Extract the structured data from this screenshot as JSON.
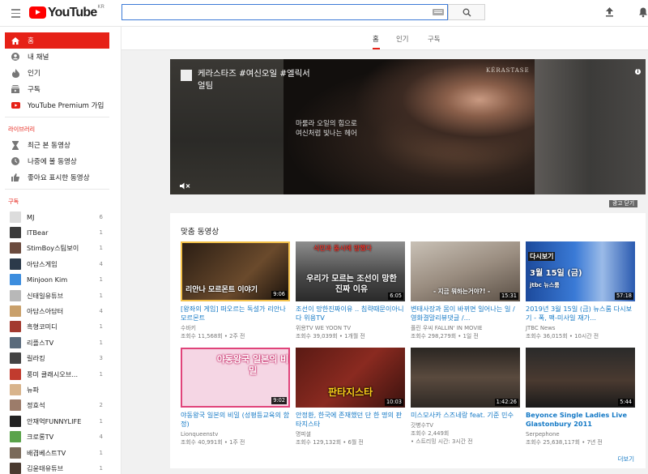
{
  "header": {
    "logo_text": "YouTube",
    "logo_region": "KR",
    "search_placeholder": ""
  },
  "sidebar": {
    "main": [
      {
        "label": "홈",
        "icon": "home-icon",
        "active": true
      },
      {
        "label": "내 채널",
        "icon": "person-icon"
      },
      {
        "label": "인기",
        "icon": "flame-icon"
      },
      {
        "label": "구독",
        "icon": "subscriptions-icon"
      },
      {
        "label": "YouTube Premium 가입",
        "icon": "youtube-icon"
      }
    ],
    "library_title": "라이브러리",
    "library": [
      {
        "label": "최근 본 동영상",
        "icon": "hourglass-icon"
      },
      {
        "label": "나중에 볼 동영상",
        "icon": "clock-icon"
      },
      {
        "label": "좋아요 표시한 동영상",
        "icon": "thumbs-up-icon"
      }
    ],
    "subs_title": "구독",
    "subs": [
      {
        "name": "MJ",
        "count": "6",
        "color": "#dcdcdc"
      },
      {
        "name": "ITBear",
        "count": "1",
        "color": "#3b3b3b"
      },
      {
        "name": "StimBoy스팀보이",
        "count": "1",
        "color": "#6b4b3e"
      },
      {
        "name": "아담스게임",
        "count": "4",
        "color": "#2c3a4a"
      },
      {
        "name": "Minjoon Kim",
        "count": "1",
        "color": "#3c8dde"
      },
      {
        "name": "신태일유튜브",
        "count": "1",
        "color": "#b8b8b8"
      },
      {
        "name": "아담스아담터",
        "count": "4",
        "color": "#c9a06b"
      },
      {
        "name": "흑형코미디",
        "count": "1",
        "color": "#a33a2f"
      },
      {
        "name": "리플스TV",
        "count": "1",
        "color": "#5a6b7c"
      },
      {
        "name": "릴라킹",
        "count": "3",
        "color": "#444"
      },
      {
        "name": "풍미 클래시오브...",
        "count": "1",
        "color": "#c13b2e"
      },
      {
        "name": "뉴파",
        "count": "",
        "color": "#d8b48c"
      },
      {
        "name": "정효석",
        "count": "2",
        "color": "#9c7c6a"
      },
      {
        "name": "안재억FUNNYLIFE",
        "count": "1",
        "color": "#222"
      },
      {
        "name": "크로롱TV",
        "count": "4",
        "color": "#5aa34a"
      },
      {
        "name": "배겹베스트TV",
        "count": "1",
        "color": "#7a6a5a"
      },
      {
        "name": "김윤태유튜브",
        "count": "1",
        "color": "#4a3a30"
      },
      {
        "name": "",
        "count": "",
        "color": "#888"
      }
    ]
  },
  "tabs": [
    {
      "label": "홈"
    },
    {
      "label": "인기"
    },
    {
      "label": "구독"
    }
  ],
  "ad": {
    "title": "케라스타즈 #여신오일 #엘릭서얼팀",
    "copy_line1": "마룰라 오일의 힘으로",
    "copy_line2": "여신처럼 빛나는 헤어",
    "brand": "KÉRASTASE",
    "close_label": "광고 닫기"
  },
  "recommended": {
    "title": "맞춤 동영상",
    "more": "더보기",
    "videos": [
      {
        "title": "[왕좌의 게임] 떠오르는 독설가 리안나 모르몬트",
        "channel": "수바키",
        "meta": "조회수 11,568회 • 2주 전",
        "duration": "9:06",
        "thumb_text": "리안나 모르몬트 이야기",
        "bold": false
      },
      {
        "title": "조선이 망한진짜이유 .. 침략때문이아니다 위용TV",
        "channel": "위용TV WE YOON TV",
        "meta": "조회수 39,039회 • 1개월 전",
        "duration": "6:05",
        "thumb_text": "우리가 모르는 조선이 망한 진짜 이유",
        "thumb_top": "식민과 동시에 망했다",
        "bold": false
      },
      {
        "title": "변태사장과 몸이 바뀌면 일어나는 일 / 영화결말리뷰댓글 /...",
        "channel": "폴린 우씨 FALLIN' IN MOVIE",
        "meta": "조회수 298,279회 • 1일 전",
        "duration": "15:31",
        "thumb_text": "- 지금 뭐하는거야?! -",
        "bold": false
      },
      {
        "title": "2019년 3월 15일 (금) 뉴스룸 다시보기 - 폭, 팩-미사일 재가...",
        "channel": "JTBC News",
        "meta": "조회수 36,015회 • 10시간 전",
        "duration": "57:18",
        "thumb_text": "3월 15일 (금)",
        "thumb_top": "다시보기",
        "thumb_brand": "jtbc 뉴스룸",
        "bold": false
      },
      {
        "title": "야동왕국 일본의 비밀 (성평등교육의 함정)",
        "channel": "Lionqueenstv",
        "meta": "조회수 40,991회 • 1주 전",
        "duration": "9:02",
        "thumb_text": "야동왕국 일본의 비밀",
        "bold": false
      },
      {
        "title": "안정환, 한국에 존재했던 단 한 명의 판타지스타",
        "channel": "명피셜",
        "meta": "조회수 129,132회 • 6월 전",
        "duration": "10:03",
        "thumb_text": "판타지스타",
        "bold": false
      },
      {
        "title": "미스모사카 스즈네랑 feat. 기준 민수",
        "channel": "갓병수TV",
        "meta": "조회수 2,449회",
        "meta2": "• 스트리밍 시간: 3시간 전",
        "duration": "1:42:26",
        "thumb_text": "",
        "bold": false
      },
      {
        "title": "Beyonce Single Ladies Live Glastonbury 2011",
        "channel": "Serpephone",
        "meta": "조회수 25,638,117회 • 7년 전",
        "duration": "5:44",
        "thumb_text": "",
        "bold": true
      }
    ]
  },
  "colors": {
    "accent": "#e62117",
    "link": "#167ac6",
    "search_border": "#3d7ad6"
  }
}
